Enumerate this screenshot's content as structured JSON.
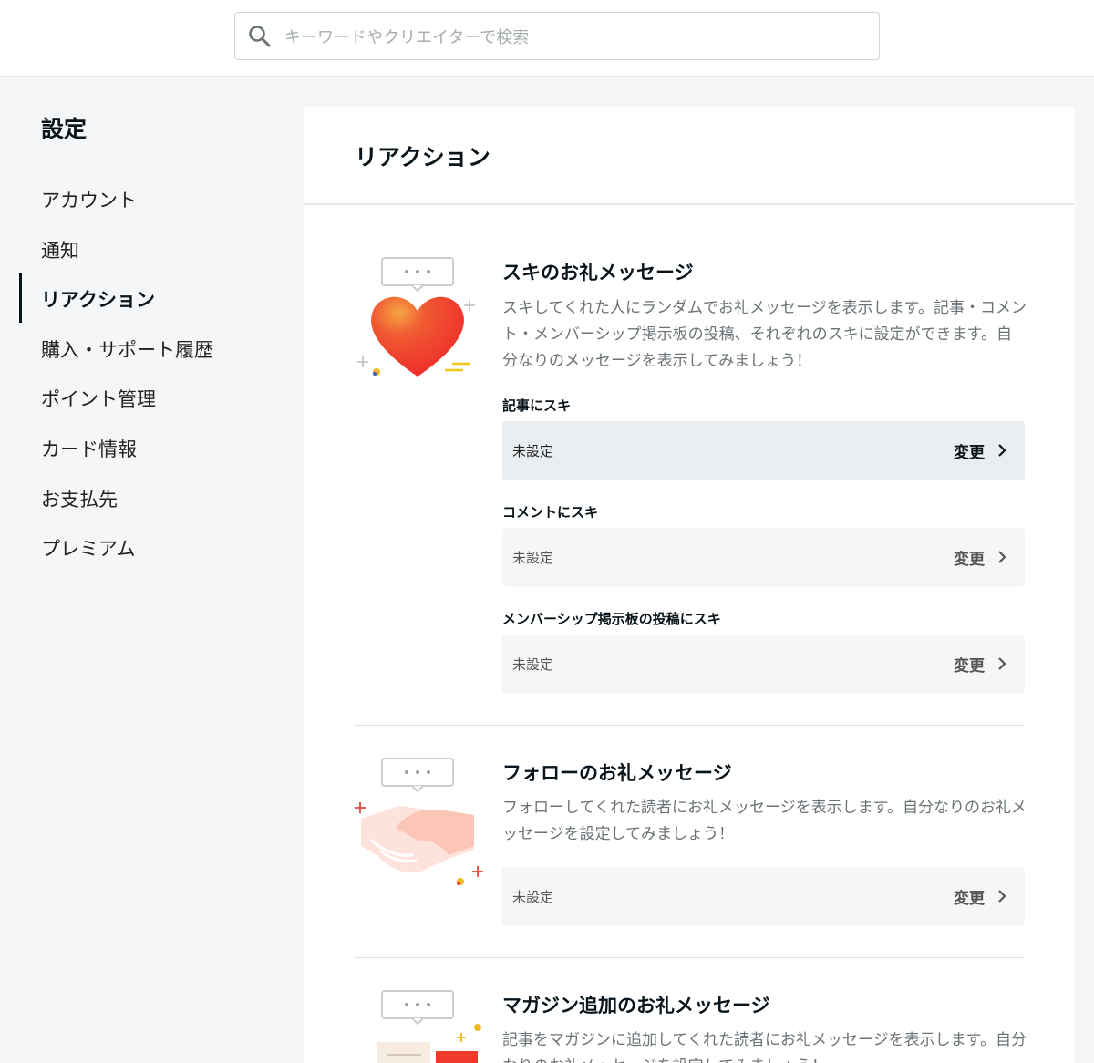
{
  "search": {
    "placeholder": "キーワードやクリエイターで検索"
  },
  "sidebar": {
    "title": "設定",
    "items": [
      {
        "label": "アカウント"
      },
      {
        "label": "通知"
      },
      {
        "label": "リアクション"
      },
      {
        "label": "購入・サポート履歴"
      },
      {
        "label": "ポイント管理"
      },
      {
        "label": "カード情報"
      },
      {
        "label": "お支払先"
      },
      {
        "label": "プレミアム"
      }
    ],
    "active_index": 2
  },
  "panel": {
    "title": "リアクション",
    "sections": [
      {
        "title": "スキのお礼メッセージ",
        "description": "スキしてくれた人にランダムでお礼メッセージを表示します。記事・コメント・メンバーシップ掲示板の投稿、それぞれのスキに設定ができます。自分なりのメッセージを表示してみましょう！",
        "fields": [
          {
            "label": "記事にスキ",
            "value": "未設定",
            "action": "変更"
          },
          {
            "label": "コメントにスキ",
            "value": "未設定",
            "action": "変更"
          },
          {
            "label": "メンバーシップ掲示板の投稿にスキ",
            "value": "未設定",
            "action": "変更"
          }
        ]
      },
      {
        "title": "フォローのお礼メッセージ",
        "description": "フォローしてくれた読者にお礼メッセージを表示します。自分なりのお礼メッセージを設定してみましょう！",
        "fields": [
          {
            "value": "未設定",
            "action": "変更"
          }
        ]
      },
      {
        "title": "マガジン追加のお礼メッセージ",
        "description": "記事をマガジンに追加してくれた読者にお礼メッセージを表示します。自分なりのお礼メッセージを設定してみましょう！"
      }
    ]
  },
  "colors": {
    "heart": "#f03a2e",
    "accent_yellow": "#f5c518",
    "text": "#08131a",
    "muted": "#6b7377"
  }
}
